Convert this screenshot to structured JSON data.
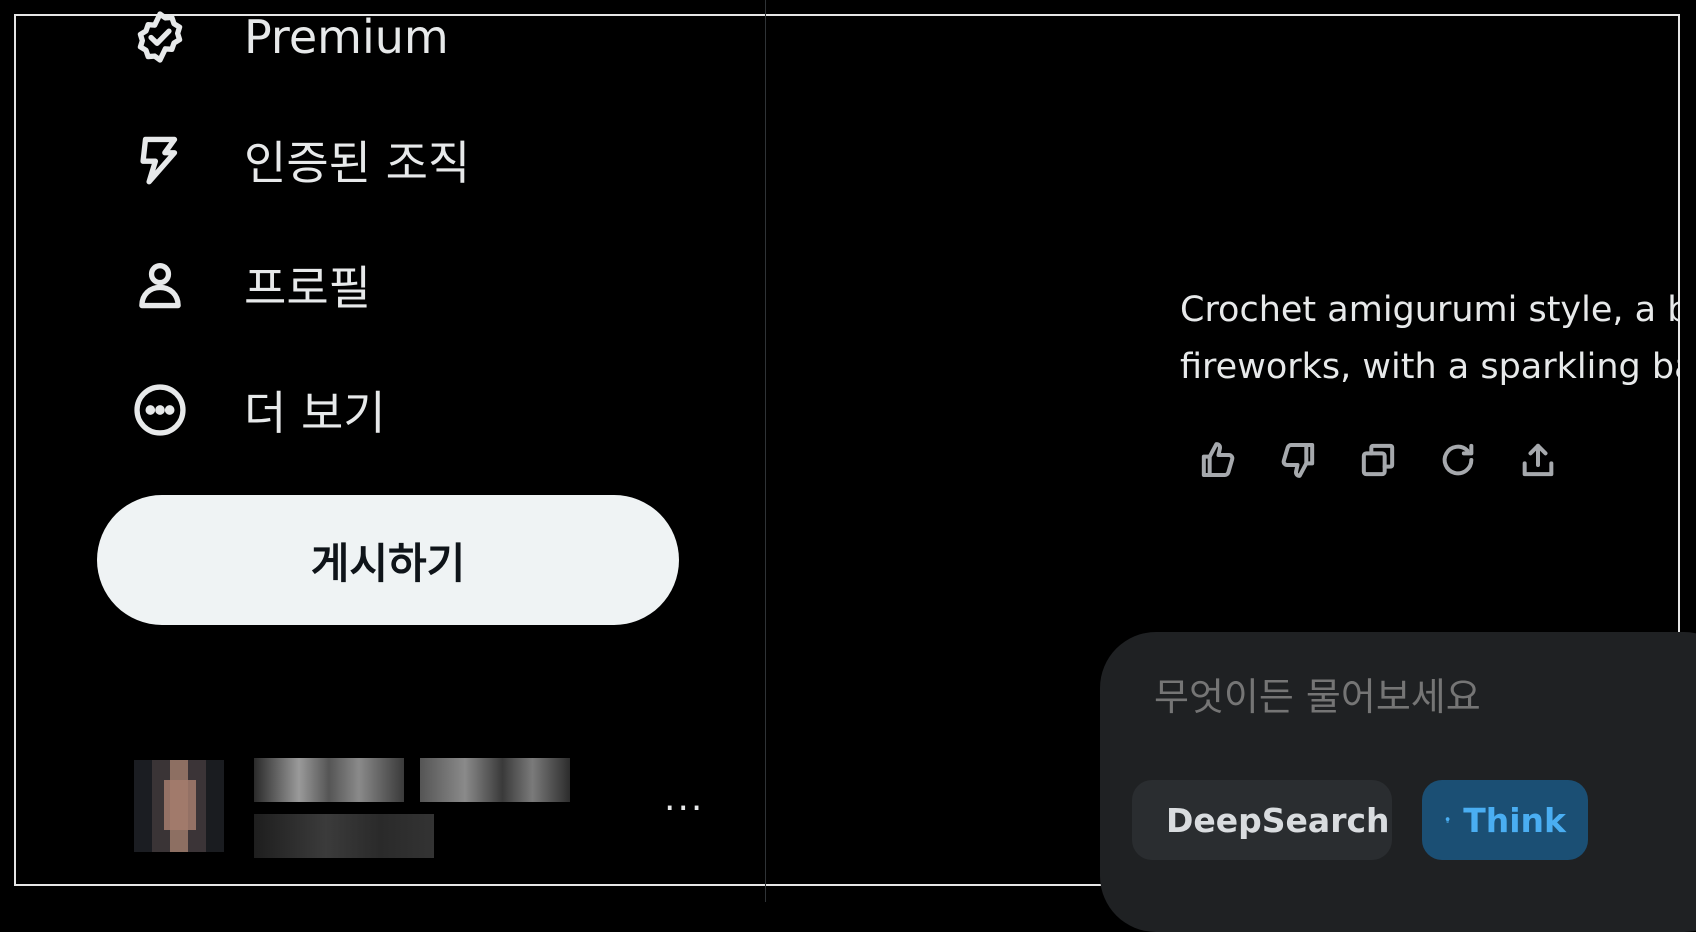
{
  "sidebar": {
    "items": [
      {
        "label": "Premium",
        "icon": "verified-badge-icon"
      },
      {
        "label": "인증된 조직",
        "icon": "lightning-icon"
      },
      {
        "label": "프로필",
        "icon": "person-icon"
      },
      {
        "label": "더 보기",
        "icon": "more-circle-icon"
      }
    ],
    "post_button": "게시하기",
    "account_more": "···"
  },
  "chat": {
    "response_lines": [
      "Crochet amigurumi style, a blue",
      "fireworks, with a sparkling back"
    ],
    "actions": [
      "thumbs-up-icon",
      "thumbs-down-icon",
      "copy-icon",
      "regenerate-icon",
      "share-icon"
    ],
    "composer": {
      "placeholder": "무엇이든 물어보세요",
      "deepsearch_label": "DeepSearch",
      "think_label": "Think"
    }
  },
  "colors": {
    "background": "#000000",
    "post_button_bg": "#eff3f4",
    "composer_bg": "#1f2123",
    "think_chip_bg": "#1b4f74",
    "think_chip_text": "#4aaef2"
  }
}
